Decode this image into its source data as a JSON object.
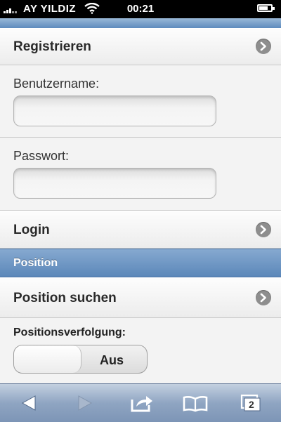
{
  "status_bar": {
    "carrier": "AY YILDIZ",
    "time": "00:21",
    "wifi_icon": "wifi-icon",
    "battery_icon": "battery-icon",
    "signal_icon": "signal-icon"
  },
  "menu": {
    "register_label": "Registrieren",
    "login_label": "Login",
    "chevron_icon": "chevron-right-icon"
  },
  "form": {
    "username_label": "Benutzername:",
    "username_value": "",
    "password_label": "Passwort:",
    "password_value": ""
  },
  "position_section": {
    "header": "Position",
    "search_label": "Position suchen",
    "tracking_label": "Positionsverfolgung:",
    "tracking_state": "Aus"
  },
  "toolbar": {
    "tabs_count": "2",
    "icons": [
      "back-arrow-icon",
      "forward-arrow-icon",
      "share-icon",
      "bookmarks-icon",
      "tabs-icon"
    ]
  },
  "colors": {
    "section_header": "#6a93c3",
    "toolbar": "#8fa5c2",
    "status_bar": "#000000"
  }
}
